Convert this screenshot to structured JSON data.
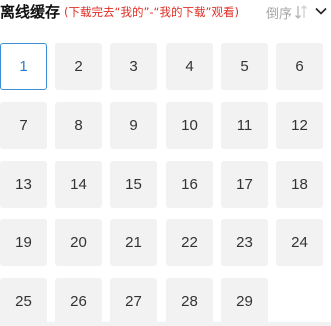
{
  "header": {
    "title": "离线缓存",
    "subtitle": "(下载完去“我的”-“我的下载”观看)",
    "sort_label": "倒序"
  },
  "icons": {
    "sort": "sort-arrows-icon",
    "collapse": "chevron-down-icon"
  },
  "colors": {
    "subtitle": "#e02e24",
    "selected_border": "#3b8fd6",
    "tile_bg": "#f2f2f2"
  },
  "episodes": {
    "selected": "1",
    "items": [
      "1",
      "2",
      "3",
      "4",
      "5",
      "6",
      "7",
      "8",
      "9",
      "10",
      "11",
      "12",
      "13",
      "14",
      "15",
      "16",
      "17",
      "18",
      "19",
      "20",
      "21",
      "22",
      "23",
      "24",
      "25",
      "26",
      "27",
      "28",
      "29"
    ]
  }
}
